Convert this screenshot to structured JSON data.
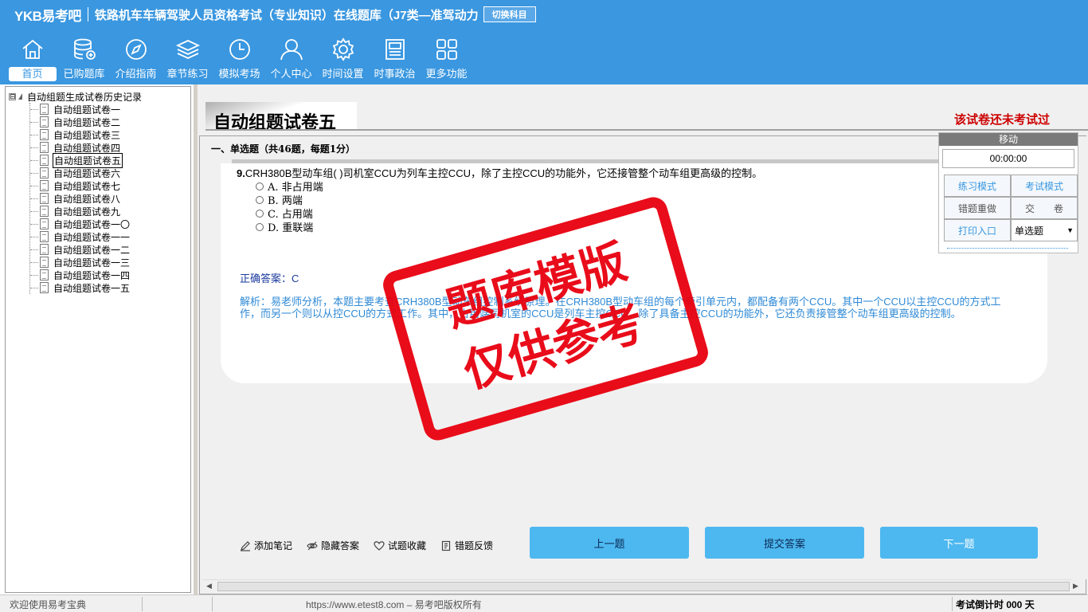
{
  "header": {
    "brand": "YKB易考吧",
    "exam_title": "铁路机车车辆驾驶人员资格考试（专业知识）在线题库（J7类—准驾动力",
    "switch_label": "切换科目",
    "nav": [
      {
        "label": "首页",
        "icon": "home-icon"
      },
      {
        "label": "已购题库",
        "icon": "database-icon"
      },
      {
        "label": "介绍指南",
        "icon": "compass-icon"
      },
      {
        "label": "章节练习",
        "icon": "layers-icon"
      },
      {
        "label": "模拟考场",
        "icon": "clock-icon"
      },
      {
        "label": "个人中心",
        "icon": "user-icon"
      },
      {
        "label": "时间设置",
        "icon": "gear-icon"
      },
      {
        "label": "时事政治",
        "icon": "news-icon"
      },
      {
        "label": "更多功能",
        "icon": "grid-icon"
      }
    ]
  },
  "sidebar": {
    "root_label": "自动组题生成试卷历史记录",
    "expander": "⊟",
    "items": [
      "自动组题试卷一",
      "自动组题试卷二",
      "自动组题试卷三",
      "自动组题试卷四",
      "自动组题试卷五",
      "自动组题试卷六",
      "自动组题试卷七",
      "自动组题试卷八",
      "自动组题试卷九",
      "自动组题试卷一〇",
      "自动组题试卷一一",
      "自动组题试卷一二",
      "自动组题试卷一三",
      "自动组题试卷一四",
      "自动组题试卷一五"
    ],
    "selected_index": 4
  },
  "paper": {
    "title": "自动组题试卷五",
    "status": "该试卷还未考试过",
    "section": "一、单选题（共46题，每题1分）"
  },
  "question": {
    "number": "9.",
    "text": "CRH380B型动车组( )司机室CCU为列车主控CCU，除了主控CCU的功能外，它还接管整个动车组更高级的控制。",
    "options": [
      "A. 非占用端",
      "B. 两端",
      "C. 占用端",
      "D. 重联端"
    ],
    "answer": "正确答案：C",
    "analysis": "解析：易老师分析，本题主要考查CRH380B型动车组控制系统原理。在CRH380B型动车组的每个牵引单元内，都配备有两个CCU。其中一个CCU以主控CCU的方式工作，而另一个则以从控CCU的方式工作。其中，占用端司机室的CCU是列车主控CCU，除了具备主控CCU的功能外，它还负责接管整个动车组更高级的控制。"
  },
  "tools": {
    "add_note": "添加笔记",
    "hide_answer": "隐藏答案",
    "favorite": "试题收藏",
    "feedback": "错题反馈"
  },
  "buttons": {
    "prev": "上一题",
    "submit": "提交答案",
    "next": "下一题"
  },
  "control": {
    "header": "移动",
    "timer": "00:00:00",
    "practice": "练习模式",
    "exam": "考试模式",
    "redo": "错题重做",
    "hand_in": "交　　卷",
    "print": "打印入口",
    "type_select": "单选题"
  },
  "watermark": {
    "line1": "题库模版",
    "line2": "仅供参考"
  },
  "status": {
    "welcome": "欢迎使用易考宝典",
    "copyright": "https://www.etest8.com – 易考吧版权所有",
    "countdown": "考试倒计时 000 天"
  },
  "colors": {
    "header_bg": "#3a97e0",
    "button_bg": "#4db8f0",
    "status_red": "#cc0000",
    "answer_blue": "#1a3a9e",
    "analysis_blue": "#2f8ad6",
    "stamp_red": "#e8000e"
  }
}
